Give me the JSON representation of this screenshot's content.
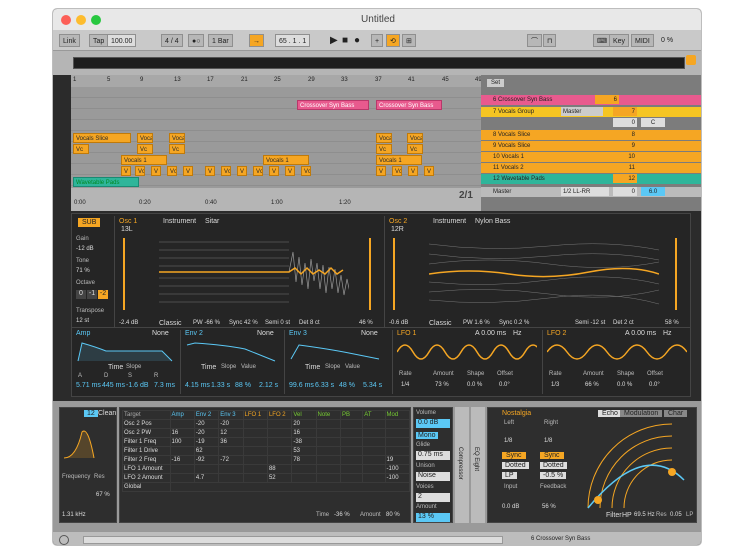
{
  "window": {
    "title": "Untitled"
  },
  "control_bar": {
    "link": "Link",
    "tap": "Tap",
    "tempo": "100.00",
    "signature": "4 / 4",
    "quant": "1 Bar",
    "position": "65 . 1 . 1",
    "key": "Key",
    "midi": "MIDI",
    "pct": "0 %"
  },
  "arrangement": {
    "ruler": [
      "1",
      "5",
      "9",
      "13",
      "17",
      "21",
      "25",
      "29",
      "33",
      "37",
      "41",
      "45",
      "49"
    ],
    "time": [
      "0:00",
      "0:20",
      "0:40",
      "1:00",
      "1:20"
    ],
    "set_label": "Set",
    "page": "2/1",
    "clips": {
      "pink": "Crossover Syn Bass",
      "vocals": "Vocals Slice",
      "vocals1": "Vocals 1",
      "vc": "Vc",
      "v": "V",
      "pads": "Wavetable Pads"
    }
  },
  "tracks": [
    {
      "name": "6 Crossover Syn Bass",
      "num": "6",
      "color": "#e85a8e"
    },
    {
      "name": "7 Vocals Group",
      "num": "7",
      "route": "Master",
      "color": "#f5c523"
    },
    {
      "name": "",
      "num": "0",
      "extra": "C"
    },
    {
      "name": "8 Vocals Slice",
      "num": "8",
      "color": "#f5a623"
    },
    {
      "name": "9 Vocals Slice",
      "num": "9",
      "color": "#f5a623"
    },
    {
      "name": "10 Vocals 1",
      "num": "10",
      "color": "#f5a623"
    },
    {
      "name": "11 Vocals 2",
      "num": "11",
      "color": "#f5a623"
    },
    {
      "name": "12 Wavetable Pads",
      "num": "12",
      "color": "#2fb59a"
    },
    {
      "name": "Master",
      "num": "0",
      "route": "1/2 LL-RR",
      "vol": "6.0"
    }
  ],
  "synth": {
    "sub": "SUB",
    "gain_label": "Gain",
    "gain": "-12 dB",
    "tone_label": "Tone",
    "tone": "71 %",
    "octave_label": "Octave",
    "oct": [
      "0",
      "-1",
      "-2"
    ],
    "transpose_label": "Transpose",
    "transpose": "12 st",
    "osc1": {
      "label": "Osc 1",
      "cat": "Instrument",
      "wave": "Sitar",
      "pos": "13L",
      "db": "-2.4 dB",
      "mode": "Classic",
      "pw": "PW -66 %",
      "sync": "Sync 42 %",
      "semi": "Semi 0 st",
      "det": "Det 8 ct",
      "pct": "46 %"
    },
    "osc2": {
      "label": "Osc 2",
      "cat": "Instrument",
      "wave": "Nylon Bass",
      "pos": "12R",
      "db": "-0.6 dB",
      "mode": "Classic",
      "pw": "PW 1.6 %",
      "sync": "Sync 0.2 %",
      "semi": "Semi -12 st",
      "det": "Det 2 ct",
      "pct": "58 %"
    }
  },
  "envs": [
    {
      "label": "Amp",
      "none": "None",
      "tabs": [
        "Time",
        "Slope"
      ],
      "adsr": [
        "A",
        "D",
        "S",
        "R"
      ],
      "vals": [
        "5.71 ms",
        "445 ms",
        "-1.6 dB",
        "7.3 ms"
      ]
    },
    {
      "label": "Env 2",
      "none": "None",
      "tabs": [
        "Time",
        "Slope",
        "Value"
      ],
      "adsr": [
        "A",
        "D",
        "S",
        "R"
      ],
      "vals": [
        "4.15 ms",
        "1.33 s",
        "88 %",
        "2.12 s"
      ]
    },
    {
      "label": "Env 3",
      "none": "None",
      "tabs": [
        "Time",
        "Slope",
        "Value"
      ],
      "adsr": [
        "A",
        "D",
        "S",
        "R"
      ],
      "vals": [
        "99.6 ms",
        "6.33 s",
        "48 %",
        "5.34 s"
      ]
    }
  ],
  "lfos": [
    {
      "label": "LFO 1",
      "time": "A 0.00 ms",
      "hz": "Hz",
      "params": [
        "Rate",
        "Amount",
        "Shape",
        "Offset"
      ],
      "vals": [
        "1/4",
        "73 %",
        "0.0 %",
        "0.0°"
      ]
    },
    {
      "label": "LFO 2",
      "time": "A 0.00 ms",
      "hz": "Hz",
      "params": [
        "Rate",
        "Amount",
        "Shape",
        "Offset"
      ],
      "vals": [
        "1/3",
        "66 %",
        "0.0 %",
        "0.0°"
      ]
    }
  ],
  "bottom": {
    "filter": {
      "clean": "Clean",
      "freq_label": "Frequency",
      "freq": "1.31 kHz",
      "res_label": "Res",
      "res": "67 %"
    },
    "matrix": {
      "cols": [
        "Target",
        "Amp",
        "Env 2",
        "Env 3",
        "LFO 1",
        "LFO 2",
        "Vel",
        "Note",
        "PB",
        "AT",
        "Mod"
      ],
      "rows": [
        {
          "t": "Osc 2 Pos",
          "v": [
            "",
            "-20",
            "-20",
            "",
            "",
            "20",
            "",
            "",
            "",
            ""
          ]
        },
        {
          "t": "Osc 2 PW",
          "v": [
            "16",
            "-20",
            "12",
            "",
            "",
            "16",
            "",
            "",
            "",
            ""
          ]
        },
        {
          "t": "Filter 1 Freq",
          "v": [
            "100",
            "-19",
            "36",
            "",
            "",
            "-38",
            "",
            "",
            "",
            ""
          ]
        },
        {
          "t": "Filter 1 Drive",
          "v": [
            "",
            "62",
            "",
            "",
            "",
            "53",
            "",
            "",
            "",
            ""
          ]
        },
        {
          "t": "Filter 2 Freq",
          "v": [
            "-16",
            "-92",
            "-72",
            "",
            "",
            "78",
            "",
            "",
            "",
            "19"
          ]
        },
        {
          "t": "LFO 1 Amount",
          "v": [
            "",
            "",
            "",
            "",
            "88",
            "",
            "",
            "",
            "",
            "-100"
          ]
        },
        {
          "t": "LFO 2 Amount",
          "v": [
            "",
            "4.7",
            "",
            "",
            "52",
            "",
            "",
            "",
            "",
            "-100"
          ]
        },
        {
          "t": "Global",
          "v": [
            "",
            "",
            "",
            "",
            "",
            "",
            "",
            "",
            "",
            ""
          ]
        }
      ],
      "time": "Time",
      "time_val": "-36 %",
      "amount": "Amount",
      "amount_val": "80 %"
    },
    "volume": {
      "label": "Volume",
      "val": "0.0 dB",
      "mono": "Mono",
      "glide": "Glide",
      "glide_val": "0.75 ms",
      "unison": "Unison",
      "unison_val": "Noise",
      "voices": "Voices",
      "voices_val": "2",
      "amount": "Amount",
      "amount_val": "13 %"
    },
    "strips": [
      "Compressor",
      "EQ Eight"
    ],
    "echo": {
      "name": "Nostalgia",
      "left": "Left",
      "right": "Right",
      "lv": "1/8",
      "rv": "1/8",
      "sync": "Sync",
      "dotted": "Dotted",
      "lp": "LP",
      "rp": "-0.5 %",
      "input": "Input",
      "input_val": "0.0 dB",
      "feedback": "Feedback",
      "feedback_val": "56 %",
      "tabs": [
        "Echo",
        "Modulation",
        "Char"
      ],
      "filter": "Filter",
      "hp": "HP",
      "hp_val": "69.5 Hz",
      "res": "Res",
      "res_val": "0.05",
      "lp_val": "1"
    },
    "status": "6 Crossover Syn Bass"
  }
}
